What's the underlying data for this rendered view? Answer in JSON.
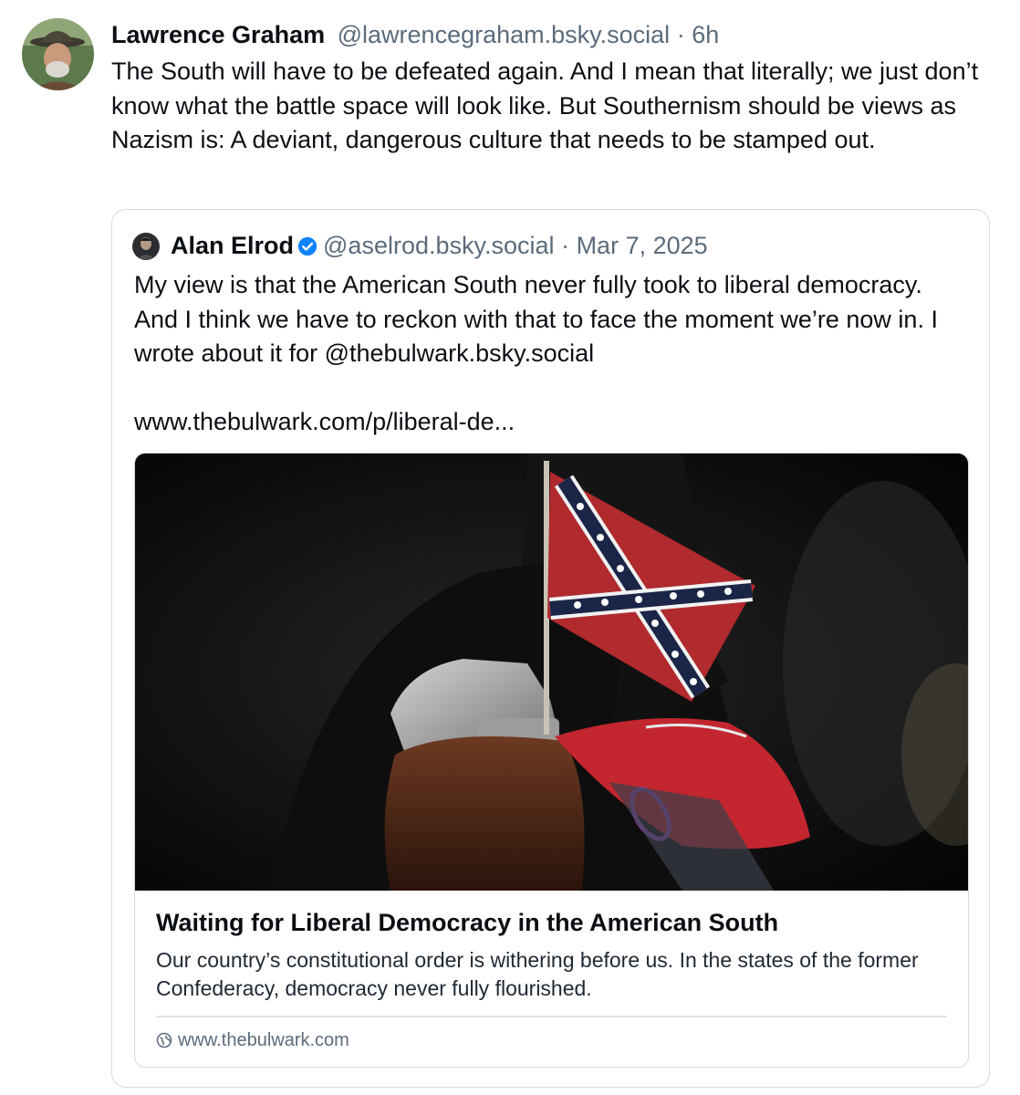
{
  "post": {
    "author": {
      "display_name": "Lawrence Graham",
      "handle": "@lawrencegraham.bsky.social",
      "avatar_icon": "avatar-photo-icon"
    },
    "separator": "·",
    "time": "6h",
    "text": "The South will have to be defeated again. And I mean that literally; we just don’t know what the battle space will look like. But Southernism should be views as Nazism is: A deviant, dangerous culture that needs to be stamped out."
  },
  "quote": {
    "author": {
      "display_name": "Alan Elrod",
      "handle": "@aselrod.bsky.social",
      "verified_icon": "verified-check-icon"
    },
    "separator": "·",
    "date": "Mar 7, 2025",
    "text": "My view is that the American South never fully took to liberal democracy. And I think we have to reckon with that to face the moment we’re now in. I wrote about it for @thebulwark.bsky.social",
    "link_text": "www.thebulwark.com/p/liberal-de...",
    "card": {
      "image_icon": "confederate-flag-revolver-photo",
      "title": "Waiting for Liberal Democracy in the American South",
      "description": "Our country’s constitutional order is withering before us. In the states of the former Confederacy, democracy never fully flourished.",
      "domain": "www.thebulwark.com",
      "domain_icon": "globe-icon"
    }
  },
  "colors": {
    "text": "#0b0f14",
    "muted": "#5b6b7c",
    "border": "#d4dbe2",
    "verified": "#1083fe"
  }
}
